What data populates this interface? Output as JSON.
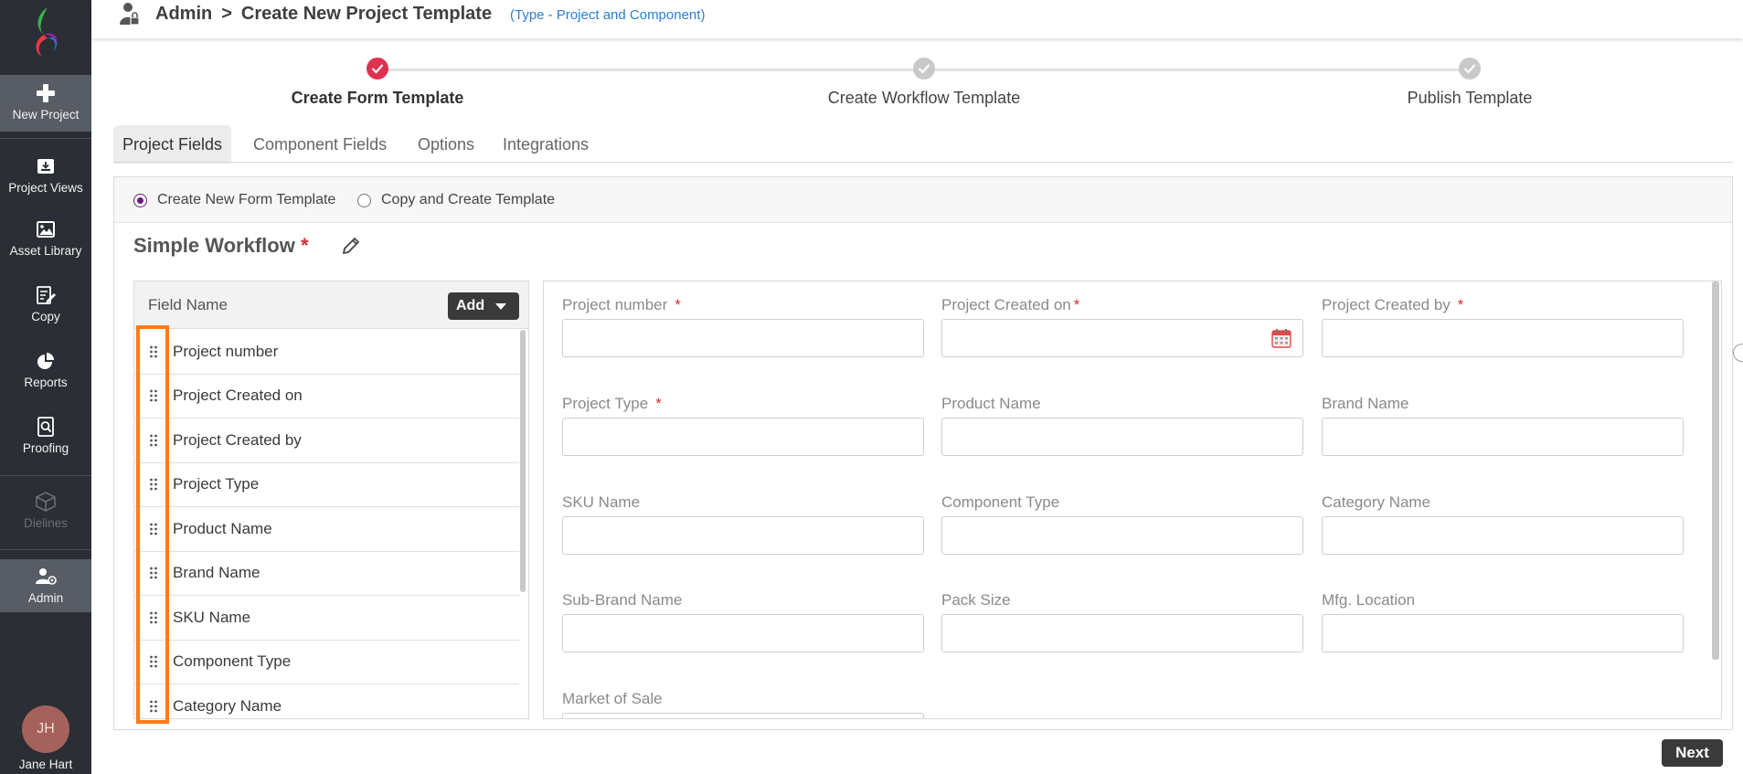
{
  "sidebar": {
    "items": [
      {
        "label": "New Project",
        "icon": "plus-icon"
      },
      {
        "label": "Project Views",
        "icon": "inbox-icon"
      },
      {
        "label": "Asset Library",
        "icon": "image-icon"
      },
      {
        "label": "Copy",
        "icon": "edit-document-icon"
      },
      {
        "label": "Reports",
        "icon": "pie-chart-icon"
      },
      {
        "label": "Proofing",
        "icon": "search-document-icon"
      },
      {
        "label": "Dielines",
        "icon": "box-icon"
      },
      {
        "label": "Admin",
        "icon": "user-settings-icon"
      }
    ],
    "user": {
      "initials": "JH",
      "name": "Jane Hart"
    }
  },
  "header": {
    "section": "Admin",
    "separator": ">",
    "page": "Create New Project Template",
    "type_note": "(Type - Project and Component)"
  },
  "stepper": {
    "steps": [
      {
        "label": "Create Form Template",
        "status": "done"
      },
      {
        "label": "Create Workflow Template",
        "status": "pending"
      },
      {
        "label": "Publish Template",
        "status": "pending"
      }
    ]
  },
  "tabs": [
    {
      "label": "Project Fields",
      "active": true
    },
    {
      "label": "Component Fields",
      "active": false
    },
    {
      "label": "Options",
      "active": false
    },
    {
      "label": "Integrations",
      "active": false
    }
  ],
  "template_mode": {
    "options": [
      "Create New Form Template",
      "Copy and Create Template"
    ],
    "selected": "Create New Form Template"
  },
  "template_name": "Simple Workflow",
  "required_mark": "*",
  "field_list": {
    "header": "Field Name",
    "add_label": "Add",
    "items": [
      "Project number",
      "Project Created on",
      "Project Created by",
      "Project Type",
      "Product Name",
      "Brand Name",
      "SKU Name",
      "Component Type",
      "Category Name"
    ]
  },
  "form_fields": [
    {
      "label": "Project number",
      "required": true,
      "value": ""
    },
    {
      "label": "Project Created on",
      "required": true,
      "value": ""
    },
    {
      "label": "Project Created by",
      "required": true,
      "value": ""
    },
    {
      "label": "Project Type",
      "required": true,
      "value": ""
    },
    {
      "label": "Product Name",
      "required": false,
      "value": ""
    },
    {
      "label": "Brand Name",
      "required": false,
      "value": ""
    },
    {
      "label": "SKU Name",
      "required": false,
      "value": ""
    },
    {
      "label": "Component Type",
      "required": false,
      "value": ""
    },
    {
      "label": "Category Name",
      "required": false,
      "value": ""
    },
    {
      "label": "Sub-Brand Name",
      "required": false,
      "value": ""
    },
    {
      "label": "Pack Size",
      "required": false,
      "value": ""
    },
    {
      "label": "Mfg. Location",
      "required": false,
      "value": ""
    },
    {
      "label": "Market of Sale",
      "required": false,
      "value": ""
    }
  ],
  "footer": {
    "next_label": "Next"
  },
  "colors": {
    "sidebar_bg": "#2b2e34",
    "accent_link": "#2a7fd4",
    "step_done": "#e0314f",
    "highlight": "#ff7a18",
    "radio_on": "#6a1a7a"
  }
}
